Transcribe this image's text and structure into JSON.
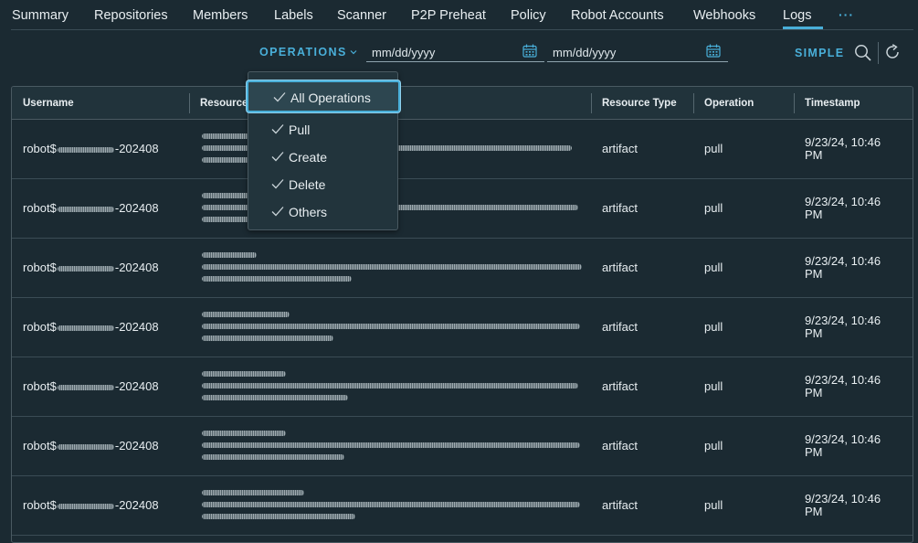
{
  "tabs": [
    {
      "label": "Summary"
    },
    {
      "label": "Repositories"
    },
    {
      "label": "Members"
    },
    {
      "label": "Labels"
    },
    {
      "label": "Scanner"
    },
    {
      "label": "P2P Preheat"
    },
    {
      "label": "Policy"
    },
    {
      "label": "Robot Accounts"
    },
    {
      "label": "Webhooks"
    },
    {
      "label": "Logs"
    }
  ],
  "more_label": "···",
  "filter": {
    "operations_label": "OPERATIONS",
    "date_from_placeholder": "mm/dd/yyyy",
    "date_to_placeholder": "mm/dd/yyyy",
    "simple_label": "SIMPLE"
  },
  "table": {
    "headers": {
      "username": "Username",
      "resource": "Resource",
      "resource_type": "Resource Type",
      "operation": "Operation",
      "timestamp": "Timestamp"
    },
    "rows": [
      {
        "user_prefix": "robot$",
        "user_suffix": "-202408",
        "resource_type": "artifact",
        "operation": "pull",
        "ts_line1": "9/23/24, 10:46",
        "ts_line2": "PM"
      },
      {
        "user_prefix": "robot$",
        "user_suffix": "-202408",
        "resource_type": "artifact",
        "operation": "pull",
        "ts_line1": "9/23/24, 10:46",
        "ts_line2": "PM"
      },
      {
        "user_prefix": "robot$",
        "user_suffix": "-202408",
        "resource_type": "artifact",
        "operation": "pull",
        "ts_line1": "9/23/24, 10:46",
        "ts_line2": "PM"
      },
      {
        "user_prefix": "robot$",
        "user_suffix": "-202408",
        "resource_type": "artifact",
        "operation": "pull",
        "ts_line1": "9/23/24, 10:46",
        "ts_line2": "PM"
      },
      {
        "user_prefix": "robot$",
        "user_suffix": "-202408",
        "resource_type": "artifact",
        "operation": "pull",
        "ts_line1": "9/23/24, 10:46",
        "ts_line2": "PM"
      },
      {
        "user_prefix": "robot$",
        "user_suffix": "-202408",
        "resource_type": "artifact",
        "operation": "pull",
        "ts_line1": "9/23/24, 10:46",
        "ts_line2": "PM"
      },
      {
        "user_prefix": "robot$",
        "user_suffix": "-202408",
        "resource_type": "artifact",
        "operation": "pull",
        "ts_line1": "9/23/24, 10:46",
        "ts_line2": "PM"
      }
    ]
  },
  "operations_menu": {
    "items": [
      {
        "label": "All Operations",
        "checked": true,
        "selected": true
      },
      {
        "label": "Pull",
        "checked": true
      },
      {
        "label": "Create",
        "checked": true
      },
      {
        "label": "Delete",
        "checked": true
      },
      {
        "label": "Others",
        "checked": true
      }
    ]
  },
  "colors": {
    "background": "#1b2a32",
    "accent": "#49afd9",
    "text": "#e8eef1",
    "border": "#4a5a62"
  },
  "icons": [
    "calendar-icon",
    "search-icon",
    "refresh-icon",
    "check-icon",
    "chevron-down-icon"
  ]
}
